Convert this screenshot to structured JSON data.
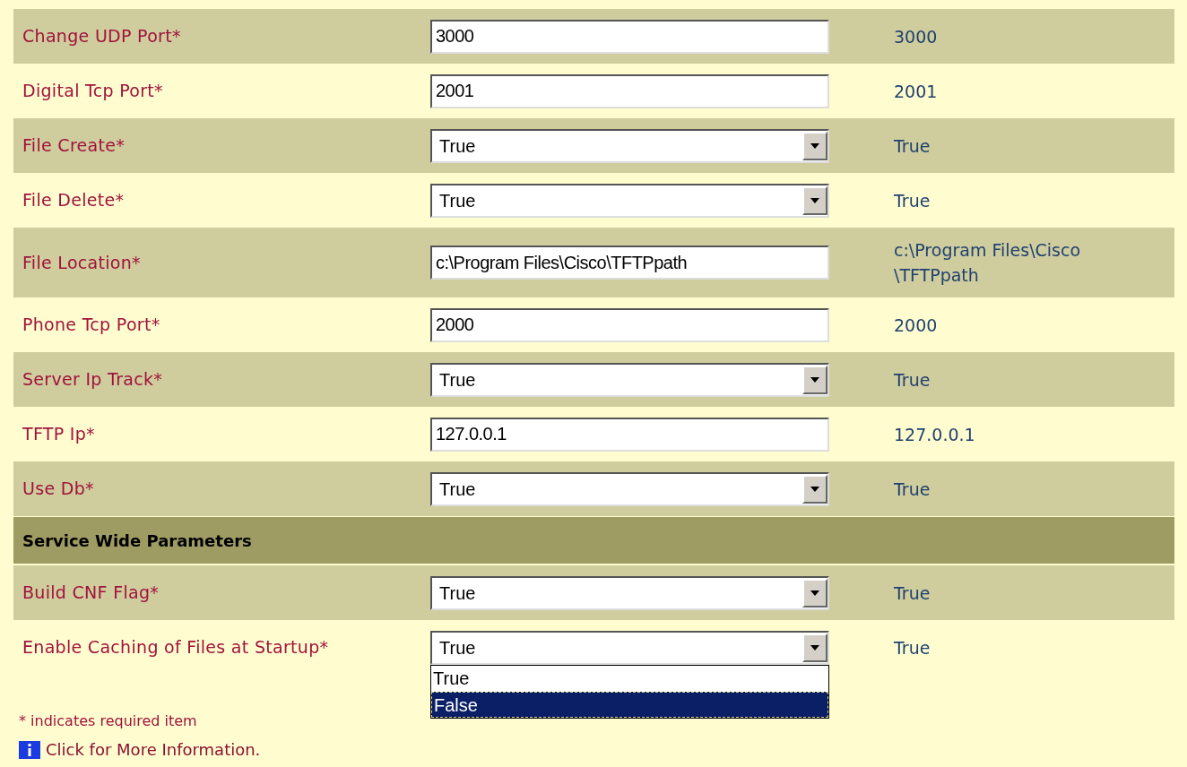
{
  "sections": [
    {
      "rows": [
        {
          "label": "Change UDP Port*",
          "control": {
            "kind": "text",
            "value": "3000"
          },
          "current": "3000"
        },
        {
          "label": "Digital Tcp Port*",
          "control": {
            "kind": "text",
            "value": "2001"
          },
          "current": "2001"
        },
        {
          "label": "File Create*",
          "control": {
            "kind": "select",
            "value": "True"
          },
          "current": "True"
        },
        {
          "label": "File Delete*",
          "control": {
            "kind": "select",
            "value": "True"
          },
          "current": "True"
        },
        {
          "label": "File Location*",
          "control": {
            "kind": "text",
            "value": "c:\\Program Files\\Cisco\\TFTPpath"
          },
          "current": "c:\\Program Files\\Cisco\\TFTPpath"
        },
        {
          "label": "Phone Tcp Port*",
          "control": {
            "kind": "text",
            "value": "2000"
          },
          "current": "2000"
        },
        {
          "label": "Server Ip Track*",
          "control": {
            "kind": "select",
            "value": "True"
          },
          "current": "True"
        },
        {
          "label": "TFTP Ip*",
          "control": {
            "kind": "text",
            "value": "127.0.0.1"
          },
          "current": "127.0.0.1"
        },
        {
          "label": "Use Db*",
          "control": {
            "kind": "select",
            "value": "True"
          },
          "current": "True"
        }
      ]
    },
    {
      "title": "Service Wide Parameters",
      "rows": [
        {
          "label": "Build CNF Flag*",
          "control": {
            "kind": "select",
            "value": "True"
          },
          "current": "True"
        },
        {
          "label": "Enable Caching of Files at Startup*",
          "control": {
            "kind": "select",
            "value": "True",
            "options": [
              {
                "label": "True",
                "highlighted": false
              },
              {
                "label": "False",
                "highlighted": true
              }
            ]
          },
          "current": "True"
        }
      ]
    }
  ],
  "note": "* indicates required item",
  "info_link": "Click for More Information."
}
